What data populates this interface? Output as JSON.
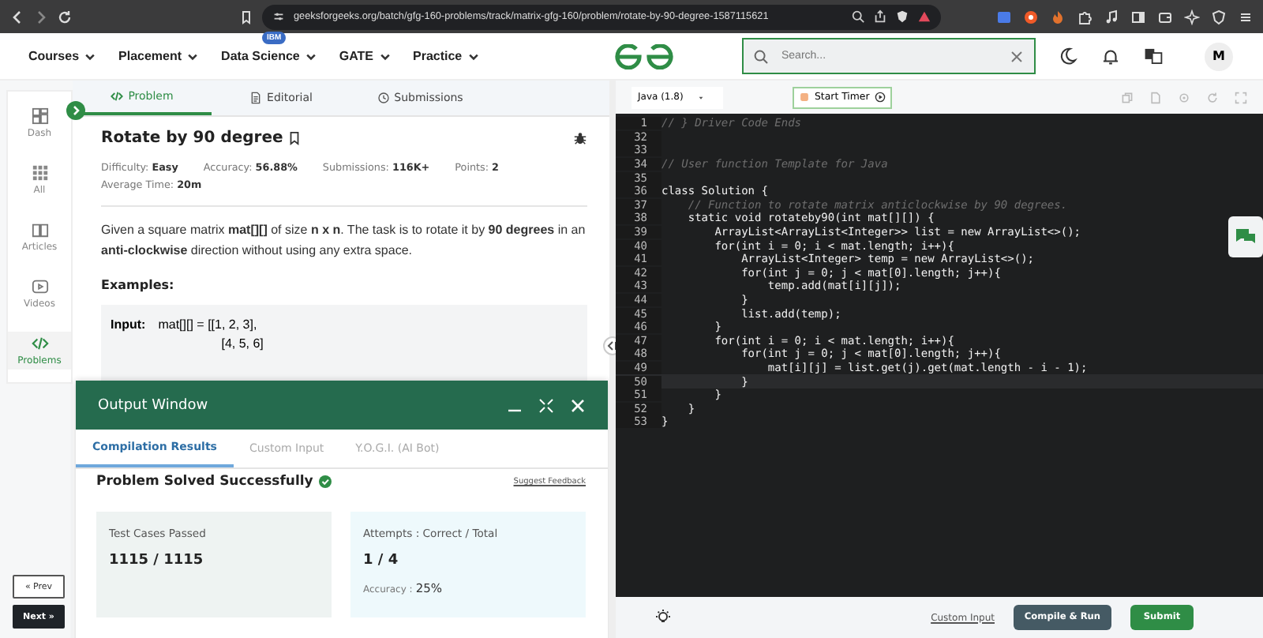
{
  "browser": {
    "url": "geeksforgeeks.org/batch/gfg-160-problems/track/matrix-gfg-160/problem/rotate-by-90-degree-1587115621"
  },
  "nav": {
    "items": [
      {
        "label": "Courses"
      },
      {
        "label": "Placement"
      },
      {
        "label": "Data Science",
        "badge": "IBM"
      },
      {
        "label": "GATE"
      },
      {
        "label": "Practice"
      }
    ],
    "search": {
      "placeholder": "Search..."
    },
    "avatar": "M"
  },
  "sidebar": {
    "items": [
      {
        "label": "Dash",
        "selected": false
      },
      {
        "label": "All",
        "selected": false
      },
      {
        "label": "Articles",
        "selected": false
      },
      {
        "label": "Videos",
        "selected": false
      },
      {
        "label": "Problems",
        "selected": true
      }
    ],
    "prev": "« Prev",
    "next": "Next »"
  },
  "problem": {
    "tabs": [
      {
        "label": "Problem",
        "selected": true
      },
      {
        "label": "Editorial",
        "selected": false
      },
      {
        "label": "Submissions",
        "selected": false
      }
    ],
    "title": "Rotate by 90 degree",
    "meta": [
      {
        "label": "Difficulty: ",
        "value": "Easy"
      },
      {
        "label": "Accuracy: ",
        "value": "56.88%"
      },
      {
        "label": "Submissions: ",
        "value": "116K+"
      },
      {
        "label": "Points: ",
        "value": "2"
      },
      {
        "label": "Average Time: ",
        "value": "20m"
      }
    ],
    "description": "Given a square matrix **mat[][]** of size **n x n**. The task is to rotate it by **90 degrees** in an **anti-clockwise** direction without using any extra space.",
    "examples_heading": "Examples:",
    "example": {
      "label": "Input:",
      "lines": [
        "mat[][] = [[1, 2, 3],",
        "[4, 5, 6]"
      ]
    }
  },
  "output_window": {
    "title": "Output Window",
    "tabs": [
      {
        "label": "Compilation Results",
        "selected": true
      },
      {
        "label": "Custom Input",
        "selected": false
      },
      {
        "label": "Y.O.G.I. (AI Bot)",
        "selected": false
      }
    ],
    "status": "Problem Solved Successfully",
    "feedback": "Suggest Feedback",
    "cards": [
      {
        "label": "Test Cases Passed",
        "value": "1115 / 1115"
      },
      {
        "label": "Attempts : Correct / Total",
        "value": "1 / 4",
        "extra_label": "Accuracy : ",
        "extra_value": "25%"
      }
    ]
  },
  "editor": {
    "language": "Java (1.8)",
    "timer": "Start Timer",
    "lines": [
      {
        "n": "1",
        "text": "// } Driver Code Ends",
        "kind": "comment",
        "active": false
      },
      {
        "n": "32",
        "active": false
      },
      {
        "n": "33",
        "active": false
      },
      {
        "n": "34",
        "text": "// User function Template for Java",
        "kind": "comment",
        "active": false
      },
      {
        "n": "35",
        "active": false
      },
      {
        "n": "36",
        "text": "class Solution {",
        "kind": "code",
        "active": false
      },
      {
        "n": "37",
        "text": "    // Function to rotate matrix anticlockwise by 90 degrees.",
        "kind": "comment",
        "active": false
      },
      {
        "n": "38",
        "text": "    static void rotateby90(int mat[][]) {",
        "kind": "code",
        "active": false
      },
      {
        "n": "39",
        "text": "        ArrayList<ArrayList<Integer>> list = new ArrayList<>();",
        "kind": "code",
        "active": false
      },
      {
        "n": "40",
        "text": "        for(int i = 0; i < mat.length; i++){",
        "kind": "code",
        "active": false
      },
      {
        "n": "41",
        "text": "            ArrayList<Integer> temp = new ArrayList<>();",
        "kind": "code",
        "active": false
      },
      {
        "n": "42",
        "text": "            for(int j = 0; j < mat[0].length; j++){",
        "kind": "code",
        "active": false
      },
      {
        "n": "43",
        "text": "                temp.add(mat[i][j]);",
        "kind": "code",
        "active": false
      },
      {
        "n": "44",
        "text": "            }",
        "kind": "code",
        "active": false
      },
      {
        "n": "45",
        "text": "            list.add(temp);",
        "kind": "code",
        "active": false
      },
      {
        "n": "46",
        "text": "        }",
        "kind": "code",
        "active": false
      },
      {
        "n": "47",
        "text": "        for(int i = 0; i < mat.length; i++){",
        "kind": "code",
        "active": false
      },
      {
        "n": "48",
        "text": "            for(int j = 0; j < mat[0].length; j++){",
        "kind": "code",
        "active": false
      },
      {
        "n": "49",
        "text": "                mat[i][j] = list.get(j).get(mat.length - i - 1);",
        "kind": "code",
        "active": false
      },
      {
        "n": "50",
        "text": "            }",
        "kind": "code",
        "active": true
      },
      {
        "n": "51",
        "text": "        }",
        "kind": "code",
        "active": false
      },
      {
        "n": "52",
        "text": "    }",
        "kind": "code",
        "active": false
      },
      {
        "n": "53",
        "text": "}",
        "kind": "code",
        "active": false
      }
    ],
    "custom_input": "Custom Input",
    "compile": "Compile & Run",
    "submit": "Submit"
  }
}
